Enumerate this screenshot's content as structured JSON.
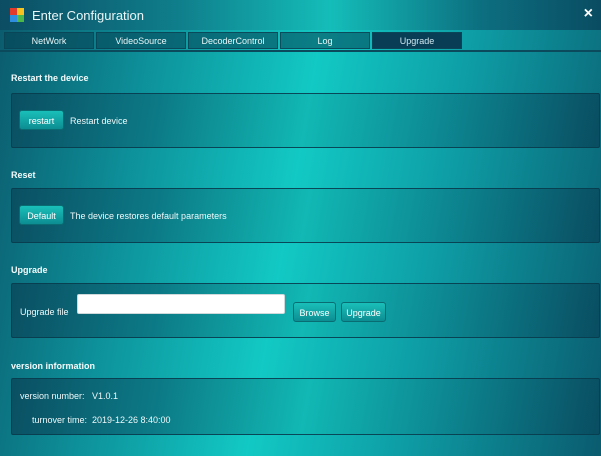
{
  "window": {
    "title": "Enter Configuration",
    "close_label": "×"
  },
  "tabs": [
    {
      "label": "NetWork"
    },
    {
      "label": "VideoSource"
    },
    {
      "label": "DecoderControl"
    },
    {
      "label": "Log"
    },
    {
      "label": "Upgrade",
      "active": true
    }
  ],
  "restart": {
    "heading": "Restart the device",
    "button": "restart",
    "description": "Restart device"
  },
  "reset": {
    "heading": "Reset",
    "button": "Default",
    "description": "The device restores default parameters"
  },
  "upgrade": {
    "heading": "Upgrade",
    "file_label": "Upgrade file",
    "file_value": "",
    "browse_button": "Browse",
    "upgrade_button": "Upgrade"
  },
  "version": {
    "heading": "version information",
    "number_label": "version number:",
    "number_value": "V1.0.1",
    "turnover_label": "turnover time:",
    "turnover_value": "2019-12-26 8:40:00"
  },
  "colors": {
    "accent": "#12c9c4",
    "dark": "#0a4f62"
  }
}
